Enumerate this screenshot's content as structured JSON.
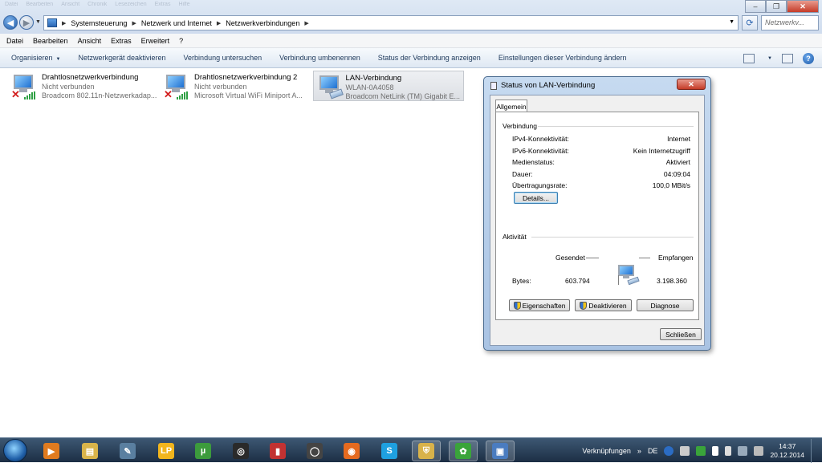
{
  "window": {
    "ghost_menu": [
      "Datei",
      "Bearbeiten",
      "Ansicht",
      "Chronik",
      "Lesezeichen",
      "Extras",
      "Hilfe"
    ],
    "controls": {
      "minimize": "–",
      "maximize": "❐",
      "close": "✕"
    }
  },
  "address": {
    "crumbs": [
      "Systemsteuerung",
      "Netzwerk und Internet",
      "Netzwerkverbindungen"
    ],
    "search_placeholder": "Netzwerkv..."
  },
  "menubar": [
    "Datei",
    "Bearbeiten",
    "Ansicht",
    "Extras",
    "Erweitert",
    "?"
  ],
  "toolbar": {
    "organize": "Organisieren",
    "actions": [
      "Netzwerkgerät deaktivieren",
      "Verbindung untersuchen",
      "Verbindung umbenennen",
      "Status der Verbindung anzeigen",
      "Einstellungen dieser Verbindung ändern"
    ]
  },
  "connections": [
    {
      "name": "Drahtlosnetzwerkverbindung",
      "status": "Nicht verbunden",
      "device": "Broadcom 802.11n-Netzwerkadap...",
      "icon": "wifi-disconnected-icon"
    },
    {
      "name": "Drahtlosnetzwerkverbindung 2",
      "status": "Nicht verbunden",
      "device": "Microsoft Virtual WiFi Miniport A...",
      "icon": "wifi-disconnected-icon"
    },
    {
      "name": "LAN-Verbindung",
      "status": "WLAN-0A4058",
      "device": "Broadcom NetLink (TM) Gigabit E...",
      "icon": "lan-icon"
    }
  ],
  "dialog": {
    "title": "Status von LAN-Verbindung",
    "tab": "Allgemein",
    "connection_group": "Verbindung",
    "rows": [
      {
        "label": "IPv4-Konnektivität:",
        "value": "Internet"
      },
      {
        "label": "IPv6-Konnektivität:",
        "value": "Kein Internetzugriff"
      },
      {
        "label": "Medienstatus:",
        "value": "Aktiviert"
      },
      {
        "label": "Dauer:",
        "value": "04:09:04"
      },
      {
        "label": "Übertragungsrate:",
        "value": "100,0 MBit/s"
      }
    ],
    "details_button": "Details...",
    "activity_group": "Aktivität",
    "sent_label": "Gesendet",
    "received_label": "Empfangen",
    "bytes_label": "Bytes:",
    "bytes_sent": "603.794",
    "bytes_received": "3.198.360",
    "properties_button": "Eigenschaften",
    "deactivate_button": "Deaktivieren",
    "diagnose_button": "Diagnose",
    "close_button": "Schließen"
  },
  "taskbar": {
    "apps": [
      {
        "name": "media-player-icon",
        "glyph": "▶",
        "color": "#e07b1f"
      },
      {
        "name": "explorer-icon",
        "glyph": "▤",
        "color": "#d9b44a"
      },
      {
        "name": "tool-icon",
        "glyph": "✎",
        "color": "#5a7fa0"
      },
      {
        "name": "lp-icon",
        "glyph": "LP",
        "color": "#f2b51d"
      },
      {
        "name": "utorrent-icon",
        "glyph": "µ",
        "color": "#3c9b3c"
      },
      {
        "name": "app-icon",
        "glyph": "◎",
        "color": "#2a2a2a"
      },
      {
        "name": "book-icon",
        "glyph": "▮",
        "color": "#c23232"
      },
      {
        "name": "search-app-icon",
        "glyph": "◯",
        "color": "#444"
      },
      {
        "name": "firefox-icon",
        "glyph": "◉",
        "color": "#e56a1f"
      },
      {
        "name": "skype-icon",
        "glyph": "S",
        "color": "#1ea0e0"
      },
      {
        "name": "security-shield-icon",
        "glyph": "⛨",
        "color": "#d8b24a"
      },
      {
        "name": "icq-icon",
        "glyph": "✿",
        "color": "#3aa43a"
      },
      {
        "name": "network-connections-icon",
        "glyph": "▣",
        "color": "#4a7cc0"
      }
    ],
    "tray_label": "Verknüpfungen",
    "lang": "DE",
    "time": "14:37",
    "date": "20.12.2014"
  }
}
